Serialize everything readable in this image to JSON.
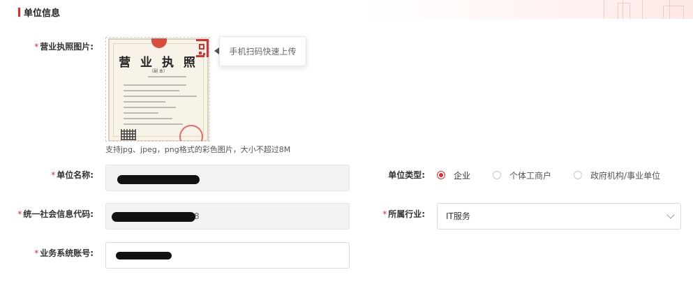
{
  "section": {
    "title": "单位信息"
  },
  "upload": {
    "label": "营业执照图片:",
    "license_title": "营 业 执 照",
    "license_subtitle": "（副 本）",
    "tooltip": "手机扫码快速上传",
    "hint": "支持jpg、jpeg，png格式的彩色图片，大小不超过8M"
  },
  "company_name": {
    "label": "单位名称:"
  },
  "credit_code": {
    "label": "统一社会信息代码:",
    "visible_suffix": "8"
  },
  "account": {
    "label": "业务系统账号:"
  },
  "company_type": {
    "label": "单位类型:",
    "options": [
      "企业",
      "个体工商户",
      "政府机构/事业单位"
    ],
    "selected": "企业"
  },
  "industry": {
    "label": "所属行业:",
    "value": "IT服务"
  },
  "colors": {
    "accent": "#e12b2b"
  },
  "icons": {
    "qr": "qr-code-icon",
    "dropdown": "chevron-down-icon"
  }
}
